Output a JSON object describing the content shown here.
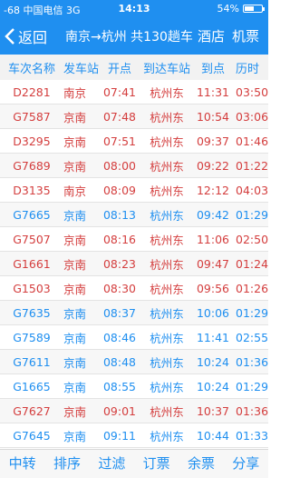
{
  "status": {
    "signal": "-68",
    "carrier": "中国电信",
    "network": "3G",
    "time": "14:13",
    "battery": "54%",
    "battery_fraction": 0.54
  },
  "nav": {
    "back_label": "返回",
    "title": "南京→杭州 共130趟车",
    "hotel": "酒店",
    "ticket": "机票"
  },
  "table": {
    "headers": [
      "车次名称",
      "发车站",
      "开点",
      "到达车站",
      "到点",
      "历时"
    ],
    "rows": [
      {
        "train": "D2281",
        "from": "南京",
        "dep": "07:41",
        "to": "杭州东",
        "arr": "11:31",
        "dur": "03:50",
        "color": "red"
      },
      {
        "train": "G7587",
        "from": "京南",
        "dep": "07:48",
        "to": "杭州东",
        "arr": "10:54",
        "dur": "03:06",
        "color": "red"
      },
      {
        "train": "D3295",
        "from": "京南",
        "dep": "07:51",
        "to": "杭州东",
        "arr": "09:37",
        "dur": "01:46",
        "color": "red"
      },
      {
        "train": "G7689",
        "from": "京南",
        "dep": "08:00",
        "to": "杭州东",
        "arr": "09:22",
        "dur": "01:22",
        "color": "red"
      },
      {
        "train": "D3135",
        "from": "南京",
        "dep": "08:09",
        "to": "杭州东",
        "arr": "12:12",
        "dur": "04:03",
        "color": "red"
      },
      {
        "train": "G7665",
        "from": "京南",
        "dep": "08:13",
        "to": "杭州东",
        "arr": "09:42",
        "dur": "01:29",
        "color": "blue"
      },
      {
        "train": "G7507",
        "from": "京南",
        "dep": "08:16",
        "to": "杭州东",
        "arr": "11:06",
        "dur": "02:50",
        "color": "red"
      },
      {
        "train": "G1661",
        "from": "京南",
        "dep": "08:23",
        "to": "杭州东",
        "arr": "09:47",
        "dur": "01:24",
        "color": "red"
      },
      {
        "train": "G1503",
        "from": "京南",
        "dep": "08:30",
        "to": "杭州东",
        "arr": "09:56",
        "dur": "01:26",
        "color": "red"
      },
      {
        "train": "G7635",
        "from": "京南",
        "dep": "08:37",
        "to": "杭州东",
        "arr": "10:06",
        "dur": "01:29",
        "color": "blue"
      },
      {
        "train": "G7589",
        "from": "京南",
        "dep": "08:46",
        "to": "杭州东",
        "arr": "11:41",
        "dur": "02:55",
        "color": "blue"
      },
      {
        "train": "G7611",
        "from": "京南",
        "dep": "08:48",
        "to": "杭州东",
        "arr": "10:24",
        "dur": "01:36",
        "color": "blue"
      },
      {
        "train": "G1665",
        "from": "京南",
        "dep": "08:55",
        "to": "杭州东",
        "arr": "10:24",
        "dur": "01:29",
        "color": "blue"
      },
      {
        "train": "G7627",
        "from": "京南",
        "dep": "09:01",
        "to": "杭州东",
        "arr": "10:37",
        "dur": "01:36",
        "color": "red"
      },
      {
        "train": "G7645",
        "from": "京南",
        "dep": "09:11",
        "to": "杭州东",
        "arr": "10:44",
        "dur": "01:33",
        "color": "blue"
      }
    ]
  },
  "tabs": [
    "中转",
    "排序",
    "过滤",
    "订票",
    "余票",
    "分享"
  ],
  "colors": {
    "accent": "#1f8ff0",
    "red": "#d43e3e"
  }
}
